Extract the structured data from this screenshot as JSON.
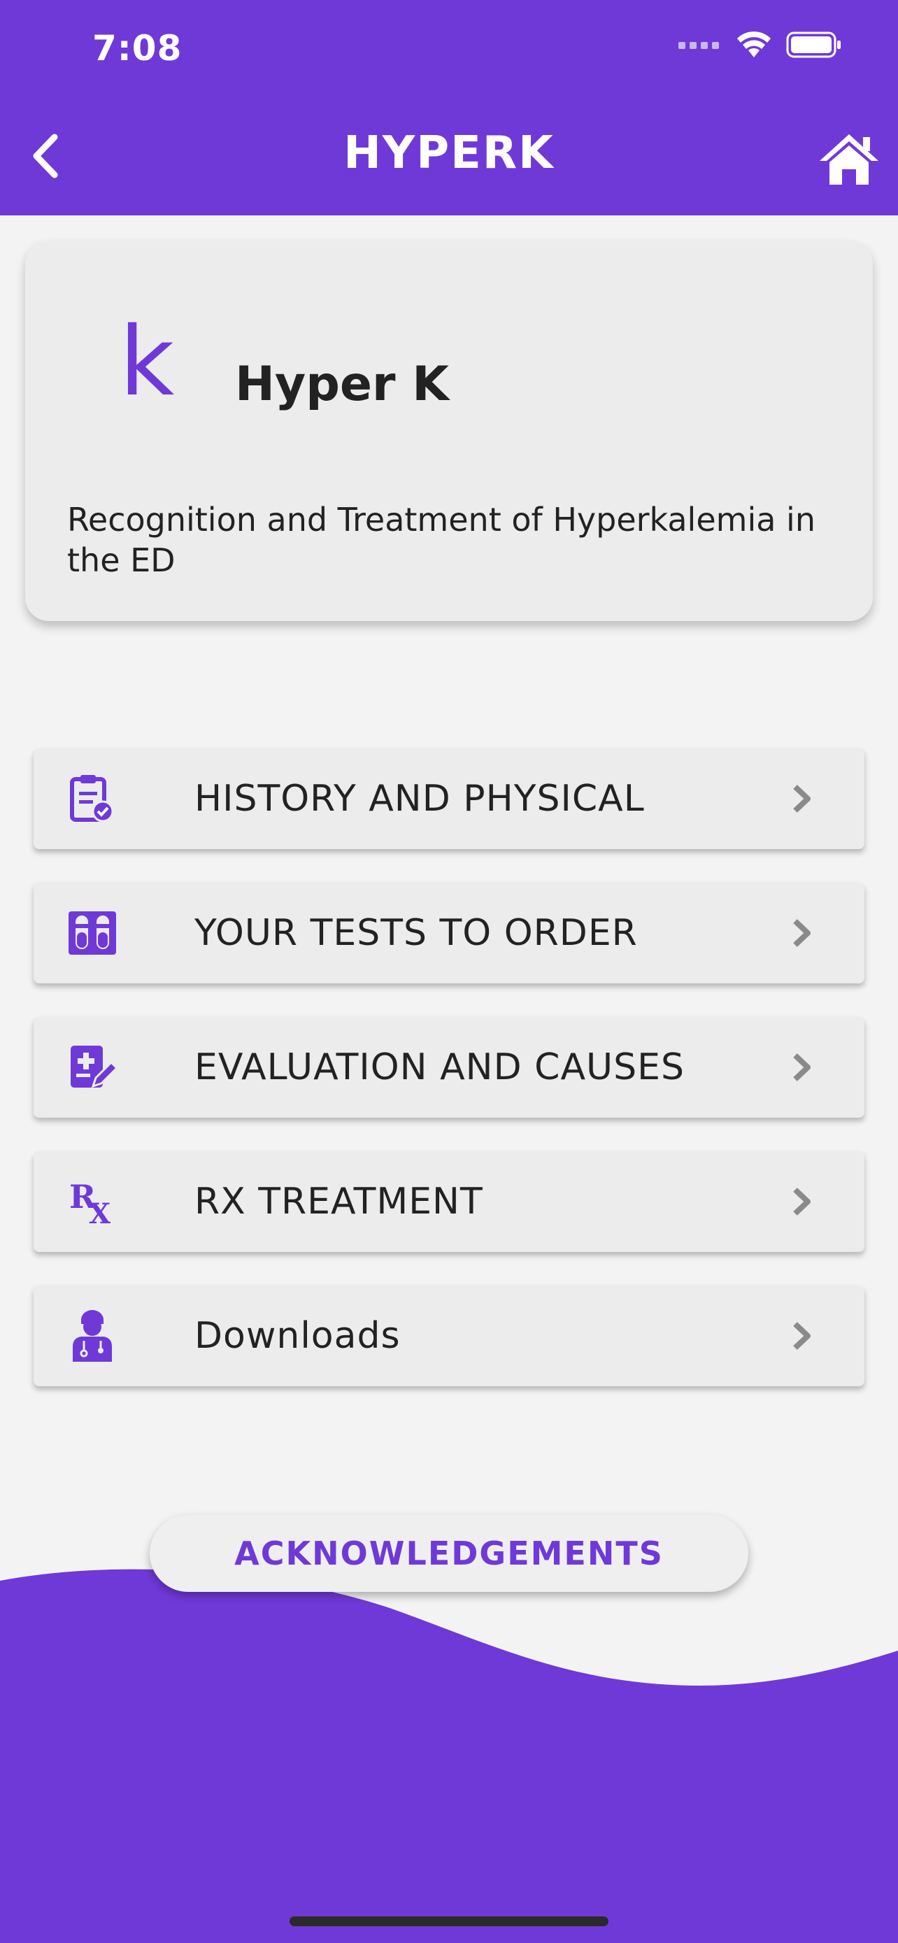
{
  "status_bar": {
    "time": "7:08",
    "icons": [
      "cellular-icon",
      "wifi-icon",
      "battery-icon"
    ]
  },
  "header": {
    "title": "HYPERK",
    "back_icon": "chevron-left-icon",
    "home_icon": "home-icon"
  },
  "info_card": {
    "letter": "k",
    "title": "Hyper K",
    "description": "Recognition and Treatment of Hyperkalemia in the ED"
  },
  "menu": [
    {
      "label": "HISTORY AND PHYSICAL",
      "icon": "clipboard-check-icon"
    },
    {
      "label": "YOUR TESTS TO ORDER",
      "icon": "test-tubes-icon"
    },
    {
      "label": "EVALUATION AND CAUSES",
      "icon": "medical-notes-icon"
    },
    {
      "label": "RX TREATMENT",
      "icon": "rx-icon"
    },
    {
      "label": "Downloads",
      "icon": "doctor-icon"
    }
  ],
  "acknowledgements_button": "ACKNOWLEDGEMENTS",
  "colors": {
    "accent": "#6f39d8",
    "background": "#f3f3f3",
    "card": "#ececec",
    "chevron": "#8a8a8a"
  }
}
